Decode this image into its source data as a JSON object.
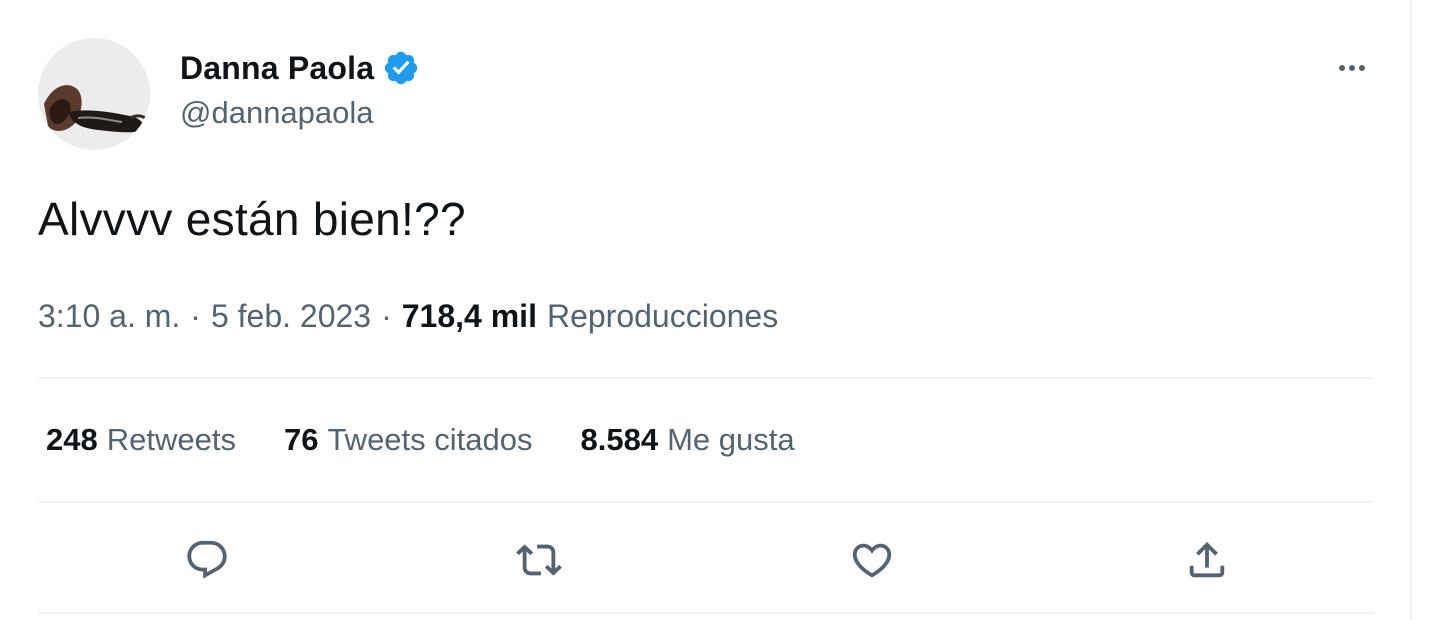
{
  "author": {
    "display_name": "Danna Paola",
    "handle": "@dannapaola",
    "verified": true,
    "verified_badge_color": "#1d9bf0"
  },
  "tweet": {
    "text": "Alvvvv están bien!??"
  },
  "meta": {
    "time": "3:10 a. m.",
    "separator": "·",
    "date": "5 feb. 2023",
    "views_count": "718,4 mil",
    "views_label": "Reproducciones"
  },
  "stats": {
    "retweets_count": "248",
    "retweets_label": "Retweets",
    "quotes_count": "76",
    "quotes_label": "Tweets citados",
    "likes_count": "8.584",
    "likes_label": "Me gusta"
  },
  "actions": [
    "reply-icon",
    "retweet-icon",
    "like-icon",
    "share-icon"
  ],
  "colors": {
    "text_primary": "#0f1419",
    "text_secondary": "#536471",
    "divider": "#eff3f4",
    "accent": "#1d9bf0"
  }
}
